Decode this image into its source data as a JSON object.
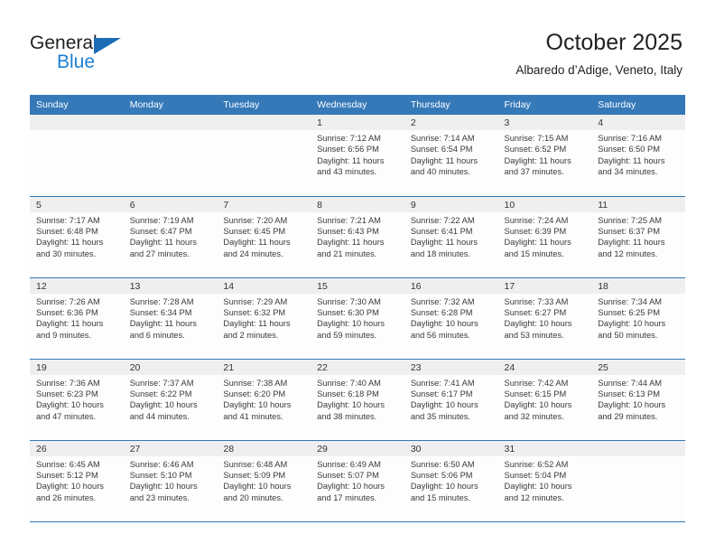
{
  "logo": {
    "word_one": "General",
    "word_two": "Blue",
    "triangle_color": "#1b6cb3",
    "blue_text_color": "#1b7fd4"
  },
  "header": {
    "title": "October 2025",
    "subtitle": "Albaredo d’Adige, Veneto, Italy"
  },
  "theme": {
    "header_band": "#3579b9",
    "daynum_band": "#efefef",
    "cell_bg": "#fdfdfd",
    "row_rule": "#3579b9"
  },
  "weekdays": [
    "Sunday",
    "Monday",
    "Tuesday",
    "Wednesday",
    "Thursday",
    "Friday",
    "Saturday"
  ],
  "weeks": [
    [
      {
        "day": "",
        "empty": true
      },
      {
        "day": "",
        "empty": true
      },
      {
        "day": "",
        "empty": true
      },
      {
        "day": "1",
        "sunrise": "Sunrise: 7:12 AM",
        "sunset": "Sunset: 6:56 PM",
        "daylight": "Daylight: 11 hours and 43 minutes."
      },
      {
        "day": "2",
        "sunrise": "Sunrise: 7:14 AM",
        "sunset": "Sunset: 6:54 PM",
        "daylight": "Daylight: 11 hours and 40 minutes."
      },
      {
        "day": "3",
        "sunrise": "Sunrise: 7:15 AM",
        "sunset": "Sunset: 6:52 PM",
        "daylight": "Daylight: 11 hours and 37 minutes."
      },
      {
        "day": "4",
        "sunrise": "Sunrise: 7:16 AM",
        "sunset": "Sunset: 6:50 PM",
        "daylight": "Daylight: 11 hours and 34 minutes."
      }
    ],
    [
      {
        "day": "5",
        "sunrise": "Sunrise: 7:17 AM",
        "sunset": "Sunset: 6:48 PM",
        "daylight": "Daylight: 11 hours and 30 minutes."
      },
      {
        "day": "6",
        "sunrise": "Sunrise: 7:19 AM",
        "sunset": "Sunset: 6:47 PM",
        "daylight": "Daylight: 11 hours and 27 minutes."
      },
      {
        "day": "7",
        "sunrise": "Sunrise: 7:20 AM",
        "sunset": "Sunset: 6:45 PM",
        "daylight": "Daylight: 11 hours and 24 minutes."
      },
      {
        "day": "8",
        "sunrise": "Sunrise: 7:21 AM",
        "sunset": "Sunset: 6:43 PM",
        "daylight": "Daylight: 11 hours and 21 minutes."
      },
      {
        "day": "9",
        "sunrise": "Sunrise: 7:22 AM",
        "sunset": "Sunset: 6:41 PM",
        "daylight": "Daylight: 11 hours and 18 minutes."
      },
      {
        "day": "10",
        "sunrise": "Sunrise: 7:24 AM",
        "sunset": "Sunset: 6:39 PM",
        "daylight": "Daylight: 11 hours and 15 minutes."
      },
      {
        "day": "11",
        "sunrise": "Sunrise: 7:25 AM",
        "sunset": "Sunset: 6:37 PM",
        "daylight": "Daylight: 11 hours and 12 minutes."
      }
    ],
    [
      {
        "day": "12",
        "sunrise": "Sunrise: 7:26 AM",
        "sunset": "Sunset: 6:36 PM",
        "daylight": "Daylight: 11 hours and 9 minutes."
      },
      {
        "day": "13",
        "sunrise": "Sunrise: 7:28 AM",
        "sunset": "Sunset: 6:34 PM",
        "daylight": "Daylight: 11 hours and 6 minutes."
      },
      {
        "day": "14",
        "sunrise": "Sunrise: 7:29 AM",
        "sunset": "Sunset: 6:32 PM",
        "daylight": "Daylight: 11 hours and 2 minutes."
      },
      {
        "day": "15",
        "sunrise": "Sunrise: 7:30 AM",
        "sunset": "Sunset: 6:30 PM",
        "daylight": "Daylight: 10 hours and 59 minutes."
      },
      {
        "day": "16",
        "sunrise": "Sunrise: 7:32 AM",
        "sunset": "Sunset: 6:28 PM",
        "daylight": "Daylight: 10 hours and 56 minutes."
      },
      {
        "day": "17",
        "sunrise": "Sunrise: 7:33 AM",
        "sunset": "Sunset: 6:27 PM",
        "daylight": "Daylight: 10 hours and 53 minutes."
      },
      {
        "day": "18",
        "sunrise": "Sunrise: 7:34 AM",
        "sunset": "Sunset: 6:25 PM",
        "daylight": "Daylight: 10 hours and 50 minutes."
      }
    ],
    [
      {
        "day": "19",
        "sunrise": "Sunrise: 7:36 AM",
        "sunset": "Sunset: 6:23 PM",
        "daylight": "Daylight: 10 hours and 47 minutes."
      },
      {
        "day": "20",
        "sunrise": "Sunrise: 7:37 AM",
        "sunset": "Sunset: 6:22 PM",
        "daylight": "Daylight: 10 hours and 44 minutes."
      },
      {
        "day": "21",
        "sunrise": "Sunrise: 7:38 AM",
        "sunset": "Sunset: 6:20 PM",
        "daylight": "Daylight: 10 hours and 41 minutes."
      },
      {
        "day": "22",
        "sunrise": "Sunrise: 7:40 AM",
        "sunset": "Sunset: 6:18 PM",
        "daylight": "Daylight: 10 hours and 38 minutes."
      },
      {
        "day": "23",
        "sunrise": "Sunrise: 7:41 AM",
        "sunset": "Sunset: 6:17 PM",
        "daylight": "Daylight: 10 hours and 35 minutes."
      },
      {
        "day": "24",
        "sunrise": "Sunrise: 7:42 AM",
        "sunset": "Sunset: 6:15 PM",
        "daylight": "Daylight: 10 hours and 32 minutes."
      },
      {
        "day": "25",
        "sunrise": "Sunrise: 7:44 AM",
        "sunset": "Sunset: 6:13 PM",
        "daylight": "Daylight: 10 hours and 29 minutes."
      }
    ],
    [
      {
        "day": "26",
        "sunrise": "Sunrise: 6:45 AM",
        "sunset": "Sunset: 5:12 PM",
        "daylight": "Daylight: 10 hours and 26 minutes."
      },
      {
        "day": "27",
        "sunrise": "Sunrise: 6:46 AM",
        "sunset": "Sunset: 5:10 PM",
        "daylight": "Daylight: 10 hours and 23 minutes."
      },
      {
        "day": "28",
        "sunrise": "Sunrise: 6:48 AM",
        "sunset": "Sunset: 5:09 PM",
        "daylight": "Daylight: 10 hours and 20 minutes."
      },
      {
        "day": "29",
        "sunrise": "Sunrise: 6:49 AM",
        "sunset": "Sunset: 5:07 PM",
        "daylight": "Daylight: 10 hours and 17 minutes."
      },
      {
        "day": "30",
        "sunrise": "Sunrise: 6:50 AM",
        "sunset": "Sunset: 5:06 PM",
        "daylight": "Daylight: 10 hours and 15 minutes."
      },
      {
        "day": "31",
        "sunrise": "Sunrise: 6:52 AM",
        "sunset": "Sunset: 5:04 PM",
        "daylight": "Daylight: 10 hours and 12 minutes."
      },
      {
        "day": "",
        "empty": true
      }
    ]
  ]
}
